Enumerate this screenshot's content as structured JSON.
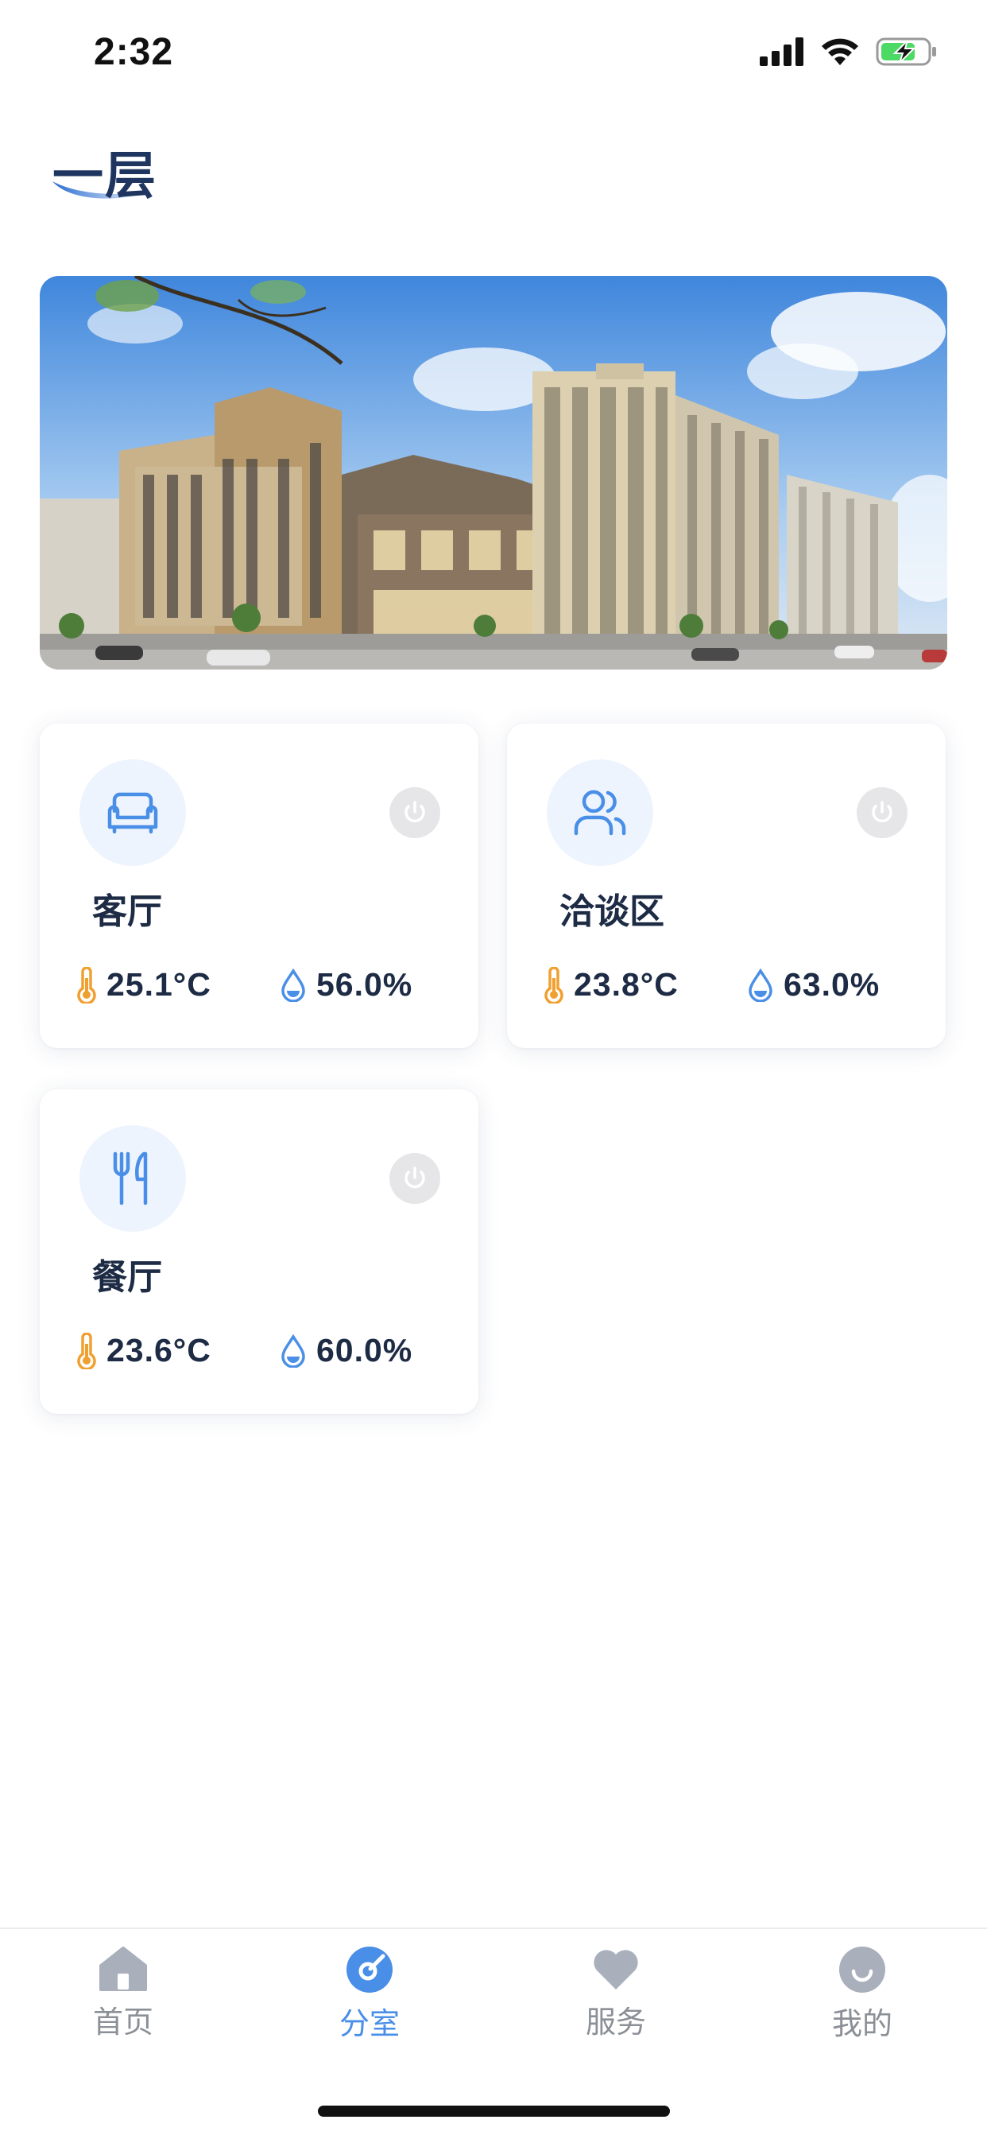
{
  "status_bar": {
    "time": "2:32"
  },
  "floor": {
    "title": "一层"
  },
  "rooms": [
    {
      "name": "客厅",
      "icon": "sofa-icon",
      "temperature": "25.1°C",
      "humidity": "56.0%"
    },
    {
      "name": "洽谈区",
      "icon": "people-icon",
      "temperature": "23.8°C",
      "humidity": "63.0%"
    },
    {
      "name": "餐厅",
      "icon": "fork-knife-icon",
      "temperature": "23.6°C",
      "humidity": "60.0%"
    }
  ],
  "tabs": [
    {
      "label": "首页",
      "icon": "home-icon"
    },
    {
      "label": "分室",
      "icon": "room-icon",
      "active": true
    },
    {
      "label": "服务",
      "icon": "heart-icon"
    },
    {
      "label": "我的",
      "icon": "user-icon"
    }
  ],
  "colors": {
    "accent": "#4a8fe7",
    "title": "#1e3560",
    "temperature_icon": "#f0a030",
    "humidity_icon": "#4a8fe7",
    "inactive_tab": "#8b8f96"
  }
}
